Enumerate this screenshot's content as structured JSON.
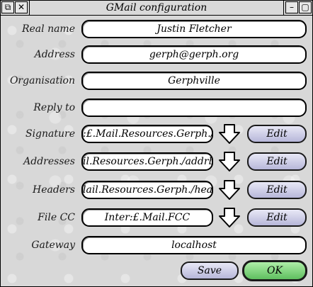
{
  "window": {
    "title": "GMail configuration",
    "back_icon": "back-icon",
    "close_icon": "close-icon",
    "iconise_icon": "iconise-icon",
    "toggle_size_icon": "toggle-size-icon"
  },
  "fields": {
    "real_name": {
      "label": "Real name",
      "value": "Justin Fletcher"
    },
    "address": {
      "label": "Address",
      "value": "gerph@gerph.org"
    },
    "organisation": {
      "label": "Organisation",
      "value": "Gerphville"
    },
    "reply_to": {
      "label": "Reply to",
      "value": ""
    },
    "signature": {
      "label": "Signature",
      "value": ":£.Mail.Resources.Gerph./sig",
      "button": "Edit"
    },
    "addresses": {
      "label": "Addresses",
      "value": "il.Resources.Gerph./addrbook",
      "button": "Edit"
    },
    "headers": {
      "label": "Headers",
      "value": "lail.Resources.Gerph./headers",
      "button": "Edit"
    },
    "file_cc": {
      "label": "File CC",
      "value": "Inter:£.Mail.FCC",
      "button": "Edit"
    },
    "gateway": {
      "label": "Gateway",
      "value": "localhost"
    }
  },
  "actions": {
    "save": "Save",
    "ok": "OK"
  },
  "colors": {
    "edit_button": "#c8c8e6",
    "ok_button": "#7ed37a",
    "background": "#d8d8d8"
  }
}
